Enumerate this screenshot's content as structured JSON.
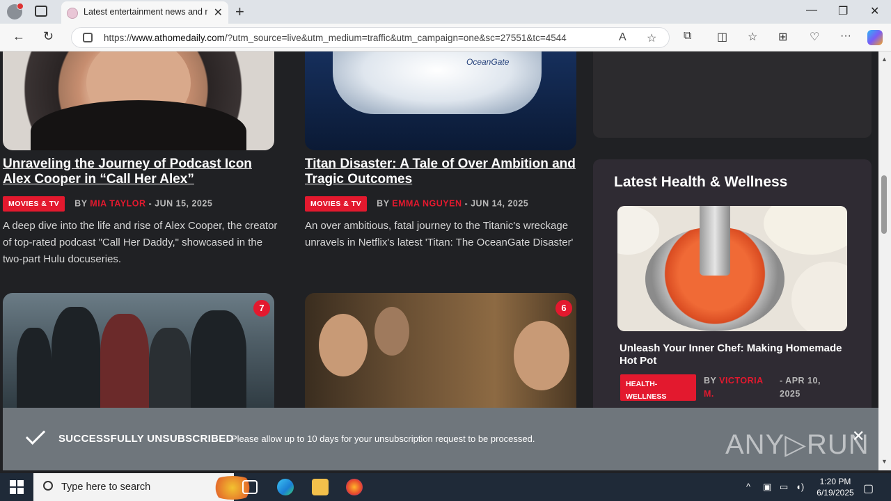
{
  "browser": {
    "tab_title": "Latest entertainment news and re",
    "url_prefix": "https://",
    "url_host": "www.athomedaily.com",
    "url_rest": "/?utm_source=live&utm_medium=traffic&utm_campaign=one&sc=27551&tc=4544"
  },
  "articles": [
    {
      "title": "Unraveling the Journey of Podcast Icon Alex Cooper in “Call Her Alex”",
      "category": "MOVIES & TV",
      "by": "BY",
      "author": "MIA TAYLOR",
      "date": "- JUN 15, 2025",
      "excerpt": "A deep dive into the life and rise of Alex Cooper, the creator of top-rated podcast \"Call Her Daddy,\" showcased in the two-part Hulu docuseries."
    },
    {
      "title": "Titan Disaster: A Tale of Over Ambition and Tragic Outcomes",
      "category": "MOVIES & TV",
      "by": "BY",
      "author": "EMMA NGUYEN",
      "date": "- JUN 14, 2025",
      "excerpt": "An over ambitious, fatal journey to the Titanic's wreckage unravels in Netflix's latest 'Titan: The OceanGate Disaster'",
      "image_text": "OceanGate"
    }
  ],
  "badges": [
    "7",
    "6"
  ],
  "sidebar": {
    "title": "Latest Health & Wellness",
    "article": {
      "title": "Unleash Your Inner Chef: Making Homemade Hot Pot",
      "category": "HEALTH-WELLNESS",
      "by": "BY",
      "author": "VICTORIA M.",
      "date": "- APR 10, 2025"
    }
  },
  "banner": {
    "heading": "SUCCESSFULLY UNSUBSCRIBED",
    "message": "Please allow up to 10 days for your unsubscription request to be processed.",
    "watermark": "ANY▷RUN"
  },
  "taskbar": {
    "search_placeholder": "Type here to search",
    "time": "1:20 PM",
    "date": "6/19/2025"
  },
  "colors": {
    "accent": "#e3192e",
    "page_bg": "#202124",
    "sidebar_bg": "#2f2b33",
    "banner_bg": "#6f767c"
  }
}
